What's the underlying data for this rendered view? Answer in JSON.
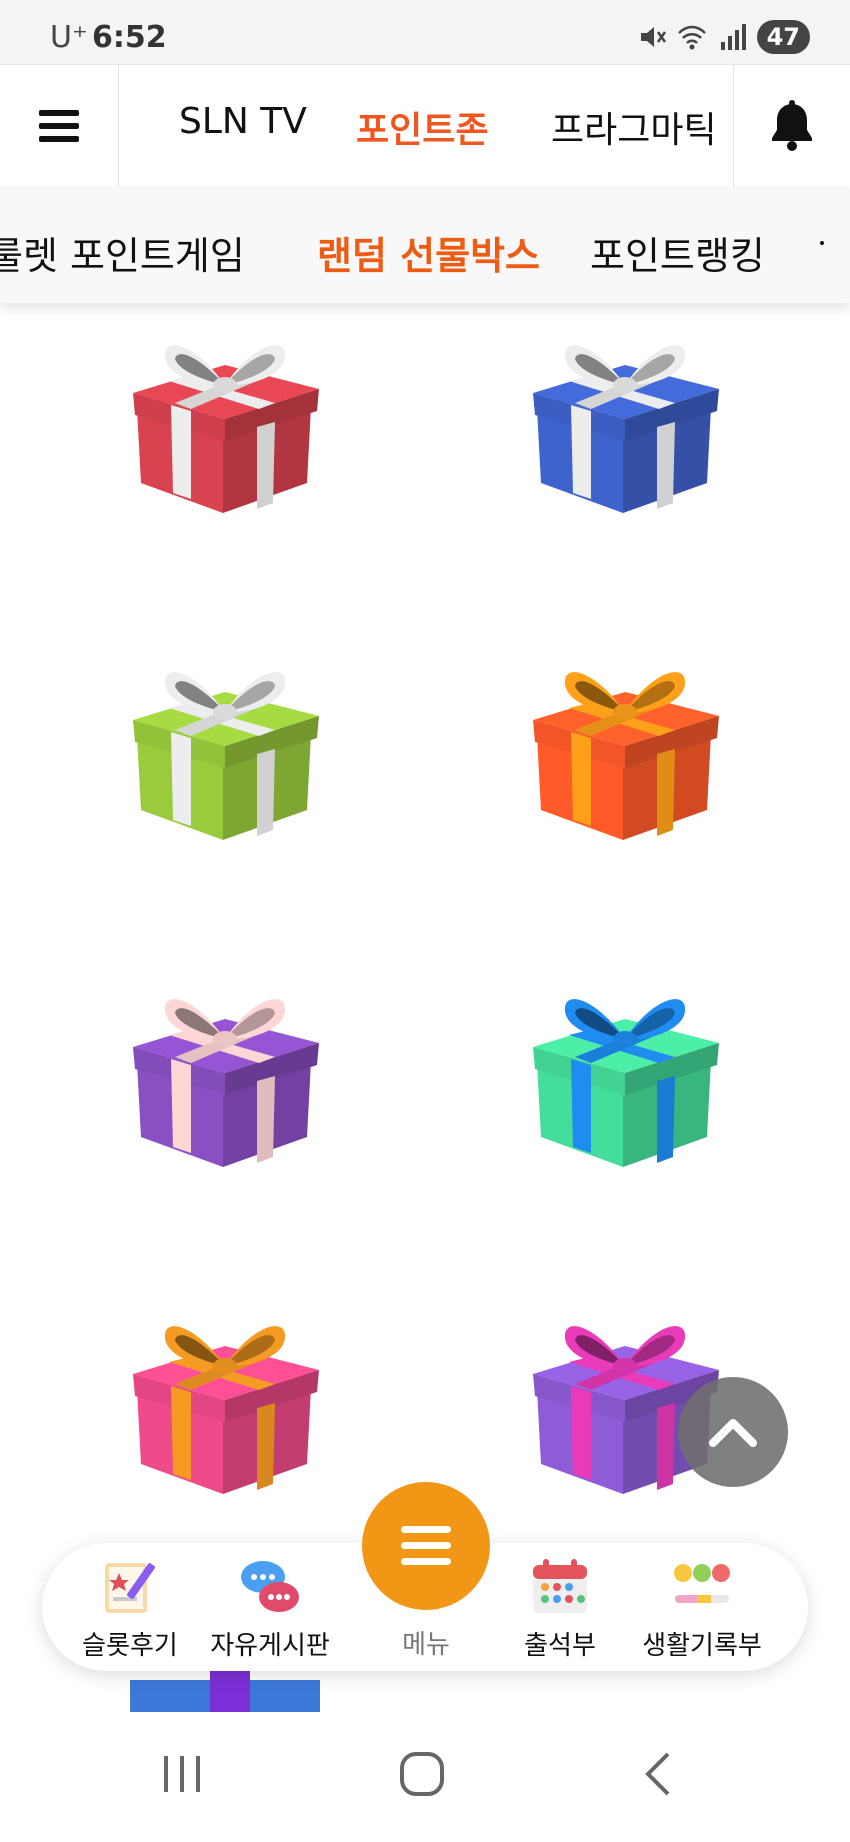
{
  "status_bar": {
    "carrier": "U⁺",
    "time": "6:52",
    "battery": "47"
  },
  "top_nav": {
    "tabs": [
      {
        "label": "SLN TV",
        "active": false
      },
      {
        "label": "포인트존",
        "active": true
      },
      {
        "label": "프라그마틱",
        "active": false
      }
    ]
  },
  "sub_nav": {
    "items": [
      {
        "label": "룰렛 포인트게임",
        "active": false
      },
      {
        "label": "랜덤 선물박스",
        "active": true
      },
      {
        "label": "포인트랭킹",
        "active": false
      }
    ]
  },
  "gifts": [
    {
      "box": "#d9424f",
      "ribbon": "#ededed",
      "bow": "#ededed"
    },
    {
      "box": "#3f63cc",
      "ribbon": "#ededed",
      "bow": "#ededed"
    },
    {
      "box": "#9acb3d",
      "ribbon": "#ededed",
      "bow": "#ededed"
    },
    {
      "box": "#ff5a2a",
      "ribbon": "#ffa01a",
      "bow": "#ffa01a"
    },
    {
      "box": "#8b4fc4",
      "ribbon": "#ffd6d6",
      "bow": "#ffd6d6"
    },
    {
      "box": "#45dd9c",
      "ribbon": "#1e8cf0",
      "bow": "#1e8cf0"
    },
    {
      "box": "#ef4a8a",
      "ribbon": "#f59a22",
      "bow": "#f59a22"
    },
    {
      "box": "#8e5cd6",
      "ribbon": "#e83ab9",
      "bow": "#e83ab9"
    }
  ],
  "dock": {
    "items": [
      {
        "label": "슬롯후기",
        "icon": "notepad-pencil-icon"
      },
      {
        "label": "자유게시판",
        "icon": "chat-bubbles-icon"
      },
      {
        "label": "출석부",
        "icon": "calendar-icon"
      },
      {
        "label": "생활기록부",
        "icon": "emoji-scale-icon"
      }
    ],
    "menu_label": "메뉴"
  },
  "colors": {
    "accent": "#f0561f",
    "fab": "#f19615"
  }
}
